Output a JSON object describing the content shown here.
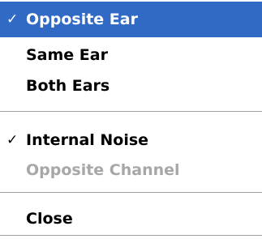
{
  "menu": {
    "items": [
      {
        "label": "Opposite Ear",
        "check": "✓"
      },
      {
        "label": "Same Ear"
      },
      {
        "label": "Both Ears"
      },
      {
        "label": "Internal Noise",
        "check": "✓"
      },
      {
        "label": "Opposite Channel"
      },
      {
        "label": "Close"
      }
    ]
  },
  "colors": {
    "highlight": "#316ac5",
    "disabled_text": "#a7a7a7",
    "separator": "#a0a0a0"
  }
}
